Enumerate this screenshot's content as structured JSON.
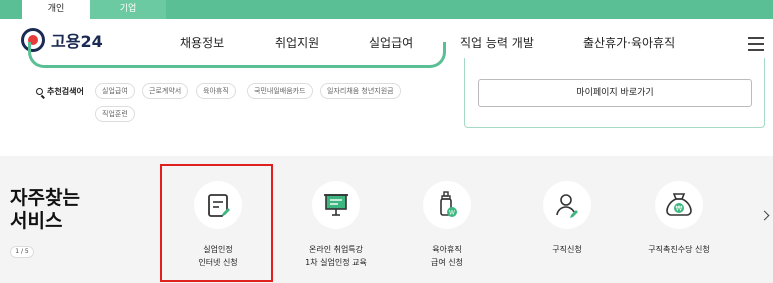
{
  "user_tabs": {
    "personal": "개인",
    "business": "기업"
  },
  "header": {
    "logo": "고용24",
    "nav": [
      "채용정보",
      "취업지원",
      "실업급여",
      "직업 능력 개발",
      "출산휴가·육아휴직"
    ]
  },
  "search": {
    "recommend_label": "추천검색어",
    "chips": [
      "실업급여",
      "근로계약서",
      "육아휴직",
      "국민내일배움카드",
      "일자리채움 청년지원금",
      "직업훈련"
    ]
  },
  "mypage_button": "마이페이지 바로가기",
  "services": {
    "title_line1": "자주찾는",
    "title_line2": "서비스",
    "pager": "1 / 5",
    "items": [
      {
        "line1": "실업인정",
        "line2": "인터넷 신청",
        "icon": "document-edit-icon"
      },
      {
        "line1": "온라인 취업특강",
        "line2": "1차 실업인정 교육",
        "icon": "presentation-board-icon"
      },
      {
        "line1": "육아휴직",
        "line2": "급여 신청",
        "icon": "baby-bottle-icon"
      },
      {
        "line1": "구직신청",
        "line2": "",
        "icon": "person-edit-icon"
      },
      {
        "line1": "구직촉진수당 신청",
        "line2": "",
        "icon": "won-money-bag-icon"
      }
    ]
  },
  "colors": {
    "accent": "#5bbf95",
    "highlight": "#e0201e",
    "navy": "#1a2a52"
  }
}
